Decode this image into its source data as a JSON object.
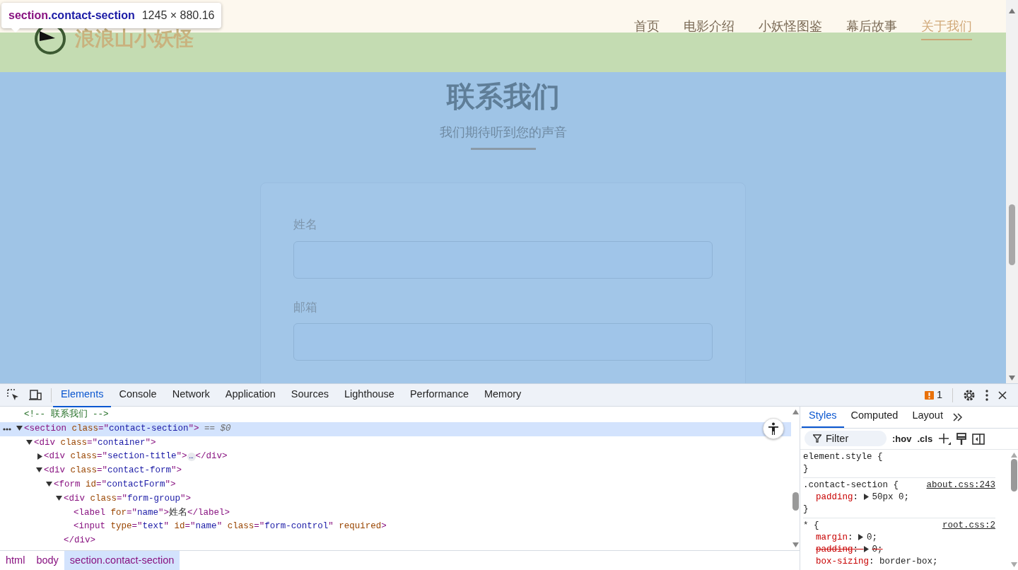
{
  "inspect_tooltip": {
    "tag": "section",
    "class_name": ".contact-section",
    "size": "1245 × 880.16"
  },
  "site": {
    "brand": "浪浪山小妖怪",
    "nav": [
      {
        "label": "首页",
        "selected": false
      },
      {
        "label": "电影介绍",
        "selected": false
      },
      {
        "label": "小妖怪图鉴",
        "selected": false
      },
      {
        "label": "幕后故事",
        "selected": false
      },
      {
        "label": "关于我们",
        "selected": true
      }
    ]
  },
  "contact": {
    "title": "联系我们",
    "subtitle": "我们期待听到您的声音",
    "fields": [
      {
        "label": "姓名"
      },
      {
        "label": "邮箱"
      }
    ]
  },
  "devtools": {
    "tabs": [
      {
        "label": "Elements",
        "selected": true
      },
      {
        "label": "Console",
        "selected": false
      },
      {
        "label": "Network",
        "selected": false
      },
      {
        "label": "Application",
        "selected": false
      },
      {
        "label": "Sources",
        "selected": false
      },
      {
        "label": "Lighthouse",
        "selected": false
      },
      {
        "label": "Performance",
        "selected": false
      },
      {
        "label": "Memory",
        "selected": false
      }
    ],
    "issues_count": "1",
    "dom": [
      {
        "kind": "leaf",
        "selected": false,
        "parts": [
          {
            "kind": "comment",
            "text": "<!-- 联系我们 -->"
          }
        ]
      },
      {
        "kind": "branch",
        "expanded": true,
        "selected": true,
        "parts": [
          {
            "kind": "tag",
            "text": "<section "
          },
          {
            "kind": "attr",
            "text": "class"
          },
          {
            "kind": "tag",
            "text": "=\""
          },
          {
            "kind": "value",
            "text": "contact-section"
          },
          {
            "kind": "tag",
            "text": "\">"
          },
          {
            "kind": "ref",
            "text": " == $0"
          }
        ],
        "children": [
          {
            "kind": "branch",
            "expanded": true,
            "selected": false,
            "parts": [
              {
                "kind": "tag",
                "text": "<div "
              },
              {
                "kind": "attr",
                "text": "class"
              },
              {
                "kind": "tag",
                "text": "=\""
              },
              {
                "kind": "value",
                "text": "container"
              },
              {
                "kind": "tag",
                "text": "\">"
              }
            ],
            "children": [
              {
                "kind": "branch",
                "expanded": false,
                "selected": false,
                "parts": [
                  {
                    "kind": "tag",
                    "text": "<div "
                  },
                  {
                    "kind": "attr",
                    "text": "class"
                  },
                  {
                    "kind": "tag",
                    "text": "=\""
                  },
                  {
                    "kind": "value",
                    "text": "section-title"
                  },
                  {
                    "kind": "tag",
                    "text": "\">"
                  },
                  {
                    "kind": "badge",
                    "text": "…"
                  },
                  {
                    "kind": "tag",
                    "text": "</div>"
                  }
                ]
              },
              {
                "kind": "branch",
                "expanded": true,
                "selected": false,
                "parts": [
                  {
                    "kind": "tag",
                    "text": "<div "
                  },
                  {
                    "kind": "attr",
                    "text": "class"
                  },
                  {
                    "kind": "tag",
                    "text": "=\""
                  },
                  {
                    "kind": "value",
                    "text": "contact-form"
                  },
                  {
                    "kind": "tag",
                    "text": "\">"
                  }
                ],
                "children": [
                  {
                    "kind": "branch",
                    "expanded": true,
                    "selected": false,
                    "parts": [
                      {
                        "kind": "tag",
                        "text": "<form "
                      },
                      {
                        "kind": "attr",
                        "text": "id"
                      },
                      {
                        "kind": "tag",
                        "text": "=\""
                      },
                      {
                        "kind": "value",
                        "text": "contactForm"
                      },
                      {
                        "kind": "tag",
                        "text": "\">"
                      }
                    ],
                    "children": [
                      {
                        "kind": "branch",
                        "expanded": true,
                        "selected": false,
                        "parts": [
                          {
                            "kind": "tag",
                            "text": "<div "
                          },
                          {
                            "kind": "attr",
                            "text": "class"
                          },
                          {
                            "kind": "tag",
                            "text": "=\""
                          },
                          {
                            "kind": "value",
                            "text": "form-group"
                          },
                          {
                            "kind": "tag",
                            "text": "\">"
                          }
                        ],
                        "close_parts": [
                          {
                            "kind": "tag",
                            "text": "</div>"
                          }
                        ],
                        "children": [
                          {
                            "kind": "leaf",
                            "selected": false,
                            "parts": [
                              {
                                "kind": "tag",
                                "text": "<label "
                              },
                              {
                                "kind": "attr",
                                "text": "for"
                              },
                              {
                                "kind": "tag",
                                "text": "=\""
                              },
                              {
                                "kind": "value",
                                "text": "name"
                              },
                              {
                                "kind": "tag",
                                "text": "\">"
                              },
                              {
                                "kind": "text",
                                "text": "姓名"
                              },
                              {
                                "kind": "tag",
                                "text": "</label>"
                              }
                            ]
                          },
                          {
                            "kind": "leaf",
                            "selected": false,
                            "parts": [
                              {
                                "kind": "tag",
                                "text": "<input "
                              },
                              {
                                "kind": "attr",
                                "text": "type"
                              },
                              {
                                "kind": "tag",
                                "text": "=\""
                              },
                              {
                                "kind": "value",
                                "text": "text"
                              },
                              {
                                "kind": "tag",
                                "text": "\" "
                              },
                              {
                                "kind": "attr",
                                "text": "id"
                              },
                              {
                                "kind": "tag",
                                "text": "=\""
                              },
                              {
                                "kind": "value",
                                "text": "name"
                              },
                              {
                                "kind": "tag",
                                "text": "\" "
                              },
                              {
                                "kind": "attr",
                                "text": "class"
                              },
                              {
                                "kind": "tag",
                                "text": "=\""
                              },
                              {
                                "kind": "value",
                                "text": "form-control"
                              },
                              {
                                "kind": "tag",
                                "text": "\" "
                              },
                              {
                                "kind": "attr",
                                "text": "required"
                              },
                              {
                                "kind": "tag",
                                "text": ">"
                              }
                            ]
                          }
                        ]
                      }
                    ]
                  }
                ]
              }
            ]
          }
        ]
      }
    ],
    "breadcrumbs": [
      {
        "label": "html",
        "selected": false
      },
      {
        "label": "body",
        "selected": false
      },
      {
        "label": "section.contact-section",
        "selected": true
      }
    ],
    "side_tabs": [
      {
        "label": "Styles",
        "selected": true
      },
      {
        "label": "Computed",
        "selected": false
      },
      {
        "label": "Layout",
        "selected": false
      }
    ],
    "filter": {
      "placeholder": "Filter"
    },
    "tool_buttons": [
      ":hov",
      ".cls"
    ],
    "rules": [
      {
        "selector": "element.style",
        "open": " {",
        "close": "}"
      },
      {
        "selector": ".contact-section",
        "open": " {",
        "close": "}",
        "source": "about.css:243",
        "declarations": [
          {
            "property": "padding",
            "sep": ": ",
            "value": "50px 0;",
            "expandable": true,
            "overridden": false
          }
        ]
      },
      {
        "selector": "*",
        "open": " {",
        "source": "root.css:2",
        "declarations": [
          {
            "property": "margin",
            "sep": ": ",
            "value": "0;",
            "expandable": true,
            "overridden": false
          },
          {
            "property": "padding",
            "sep": ": ",
            "value": "0;",
            "expandable": true,
            "overridden": true
          },
          {
            "property": "box-sizing",
            "sep": ": ",
            "value": "border-box;",
            "expandable": false,
            "overridden": false
          }
        ]
      }
    ]
  }
}
